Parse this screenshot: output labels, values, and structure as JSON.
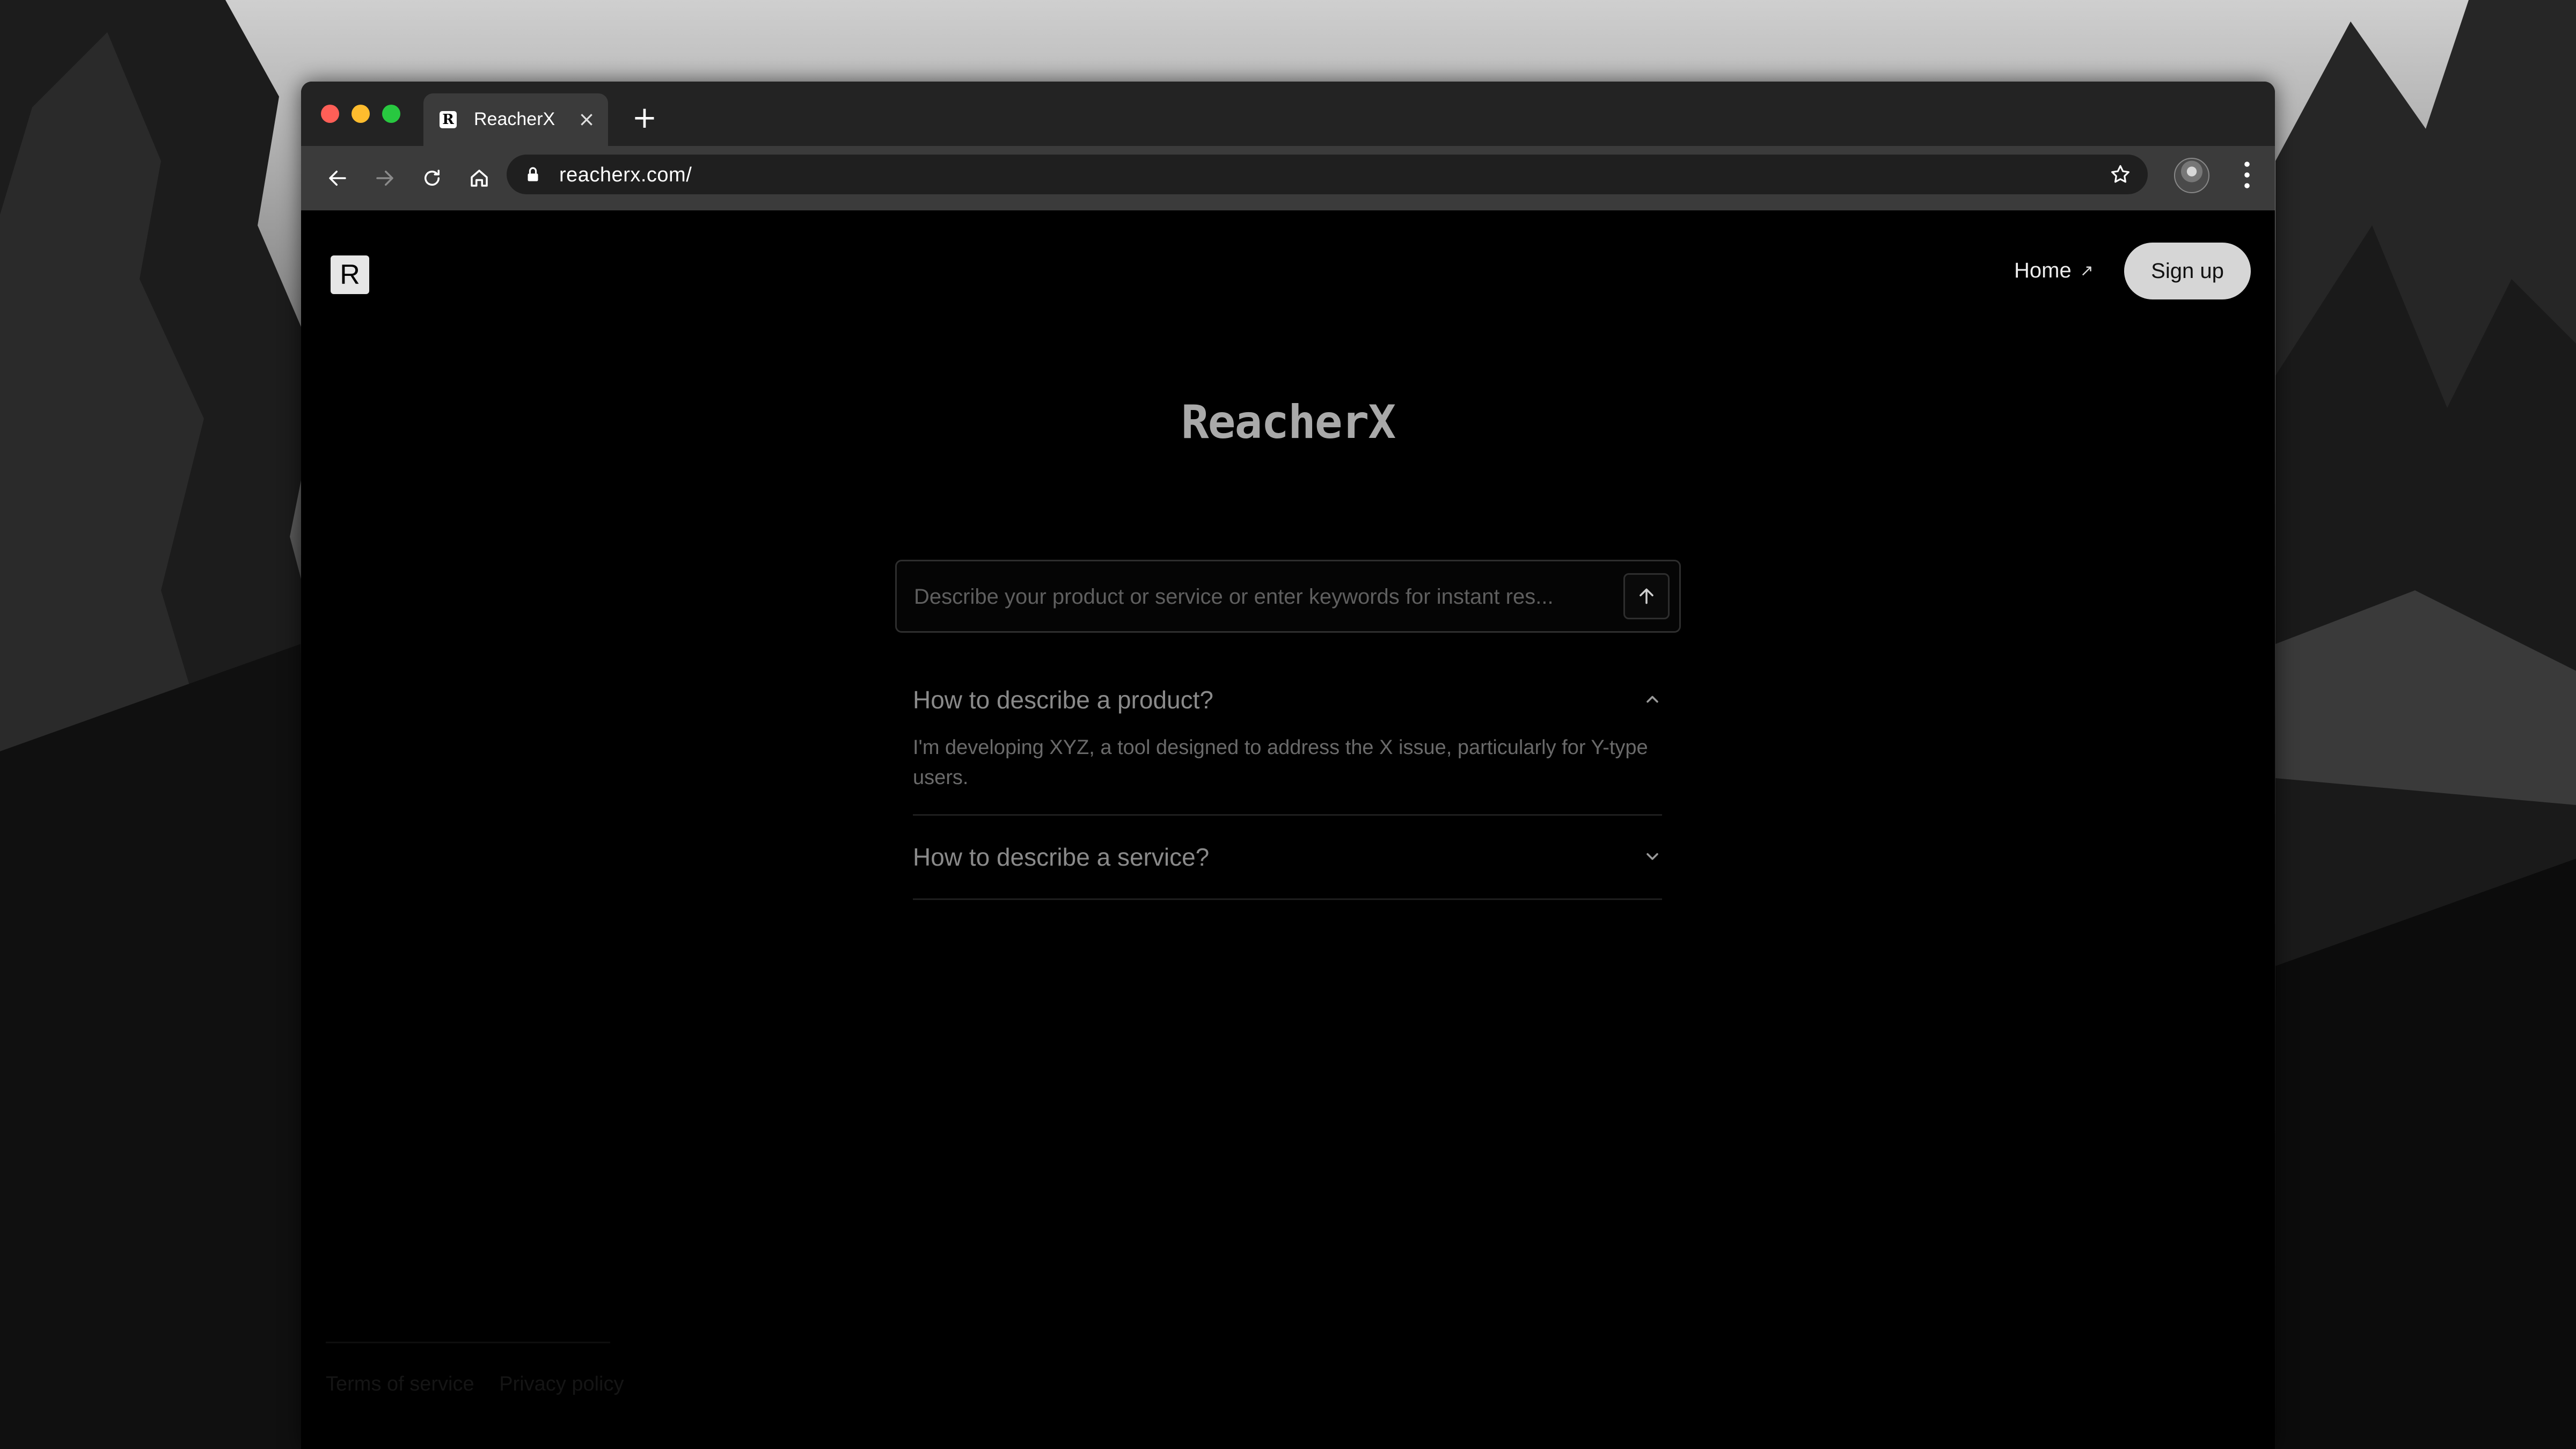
{
  "browser": {
    "tab": {
      "title": "ReacherX",
      "favicon_letter": "R"
    },
    "new_tab_symbol": "+",
    "url": "reacherx.com/"
  },
  "site": {
    "logo_letter": "R",
    "nav": {
      "home_label": "Home",
      "home_arrow": "↗",
      "signup_label": "Sign up"
    },
    "title": "ReacherX",
    "search": {
      "placeholder": "Describe your product or service or enter keywords for instant res...",
      "value": ""
    },
    "faq": [
      {
        "question": "How to describe a product?",
        "answer": "I'm developing XYZ, a tool designed to address the X issue, particularly for Y-type users.",
        "expanded": true
      },
      {
        "question": "How to describe a service?",
        "answer": "",
        "expanded": false
      }
    ],
    "footer": {
      "terms": "Terms of service",
      "privacy": "Privacy policy"
    }
  },
  "colors": {
    "page_bg": "#000000",
    "titlebar": "#232323",
    "toolbar": "#3b3b3b",
    "signup_bg": "#d6d6d6",
    "traffic_red": "#ff5f57",
    "traffic_yellow": "#febc2e",
    "traffic_green": "#28c840"
  },
  "icons": [
    "back-arrow-icon",
    "forward-arrow-icon",
    "reload-icon",
    "home-icon",
    "lock-icon",
    "star-icon",
    "profile-avatar",
    "kebab-menu-icon",
    "arrow-up-icon",
    "chevron-up-icon",
    "chevron-down-icon"
  ]
}
